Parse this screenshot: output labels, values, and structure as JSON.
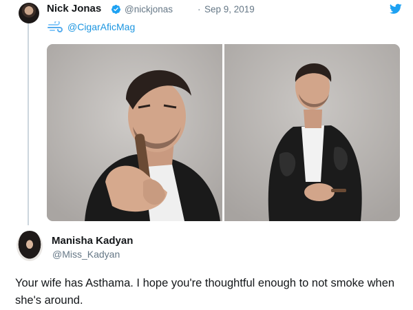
{
  "original_tweet": {
    "author_name": "Nick Jonas",
    "author_handle": "@nickjonas",
    "separator": "·",
    "date": "Sep 9, 2019",
    "mention": "@CigarAficMag",
    "verified": true,
    "photos": [
      {
        "icon": "portrait-with-cigar"
      },
      {
        "icon": "portrait-full-body"
      }
    ]
  },
  "reply": {
    "author_name": "Manisha Kadyan",
    "author_handle": "@Miss_Kadyan",
    "text": "Your wife has Asthama. I hope you're thoughtful enough to not smoke when she's around."
  },
  "colors": {
    "link": "#1b95e0",
    "twitter_blue": "#1da1f2",
    "muted": "#657786",
    "text": "#14171a"
  }
}
